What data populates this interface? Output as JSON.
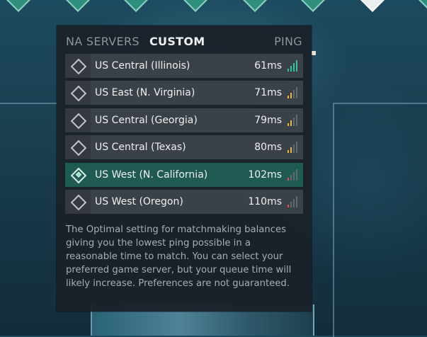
{
  "header": {
    "na_servers": "NA SERVERS",
    "custom": "CUSTOM",
    "ping": "PING"
  },
  "servers": [
    {
      "name": "US Central (Illinois)",
      "ping": "61ms",
      "bars": 4,
      "signal_color": "#2fc7a0",
      "selected": false
    },
    {
      "name": "US East (N. Virginia)",
      "ping": "71ms",
      "bars": 2,
      "signal_color": "#e7b93a",
      "selected": false
    },
    {
      "name": "US Central (Georgia)",
      "ping": "79ms",
      "bars": 2,
      "signal_color": "#e7b93a",
      "selected": false
    },
    {
      "name": "US Central (Texas)",
      "ping": "80ms",
      "bars": 2,
      "signal_color": "#e7b93a",
      "selected": false
    },
    {
      "name": "US West (N. California)",
      "ping": "102ms",
      "bars": 1,
      "signal_color": "#e0524e",
      "selected": true
    },
    {
      "name": "US West (Oregon)",
      "ping": "110ms",
      "bars": 1,
      "signal_color": "#e0524e",
      "selected": false
    }
  ],
  "description": "The Optimal setting for matchmaking balances giving you the lowest ping possible in a reasonable time to match. You can select your preferred game server, but your queue time will likely increase. Preferences are not guaranteed.",
  "icons": {
    "checkbox": "diamond-checkbox-icon",
    "signal": "signal-strength-icon"
  },
  "colors": {
    "panel_bg": "#1a2128",
    "row_bg": "#3b4148",
    "selected_bg": "#1f5b52",
    "good": "#2fc7a0",
    "medium": "#e7b93a",
    "poor": "#e0524e"
  }
}
